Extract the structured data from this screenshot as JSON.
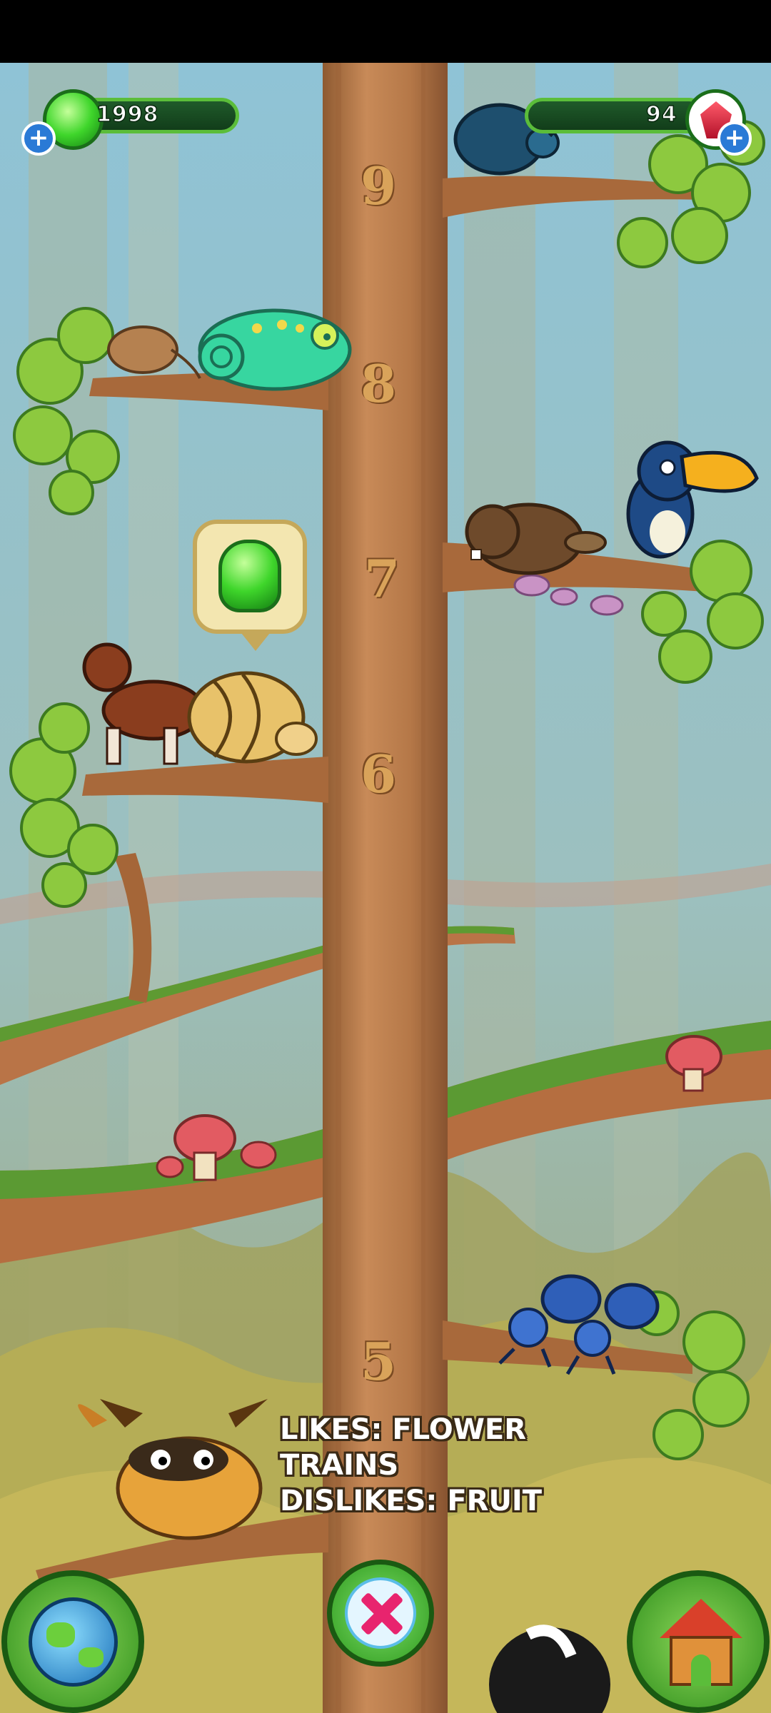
{
  "hud": {
    "jelly_count": "1998",
    "gem_count": "94",
    "jelly_icon": "green-jelly-icon",
    "gem_icon": "red-gem-icon",
    "add_icon": "plus-icon"
  },
  "tree": {
    "floors": [
      "9",
      "8",
      "7",
      "6",
      "5"
    ]
  },
  "pet_info": {
    "line1": "LIKES: FLOWER",
    "line2": "TRAINS",
    "line3": "DISLIKES: FRUIT"
  },
  "bubble": {
    "icon": "green-jelly-icon"
  },
  "buttons": {
    "world": "globe-icon",
    "cancel": "close-x-icon",
    "home": "house-icon"
  },
  "colors": {
    "trunk": "#b87a4b",
    "hud_border": "#5bbd3a",
    "hud_fill": "#1a4a22",
    "number_gold": "#d9a35a",
    "cancel_x": "#e8246e"
  }
}
